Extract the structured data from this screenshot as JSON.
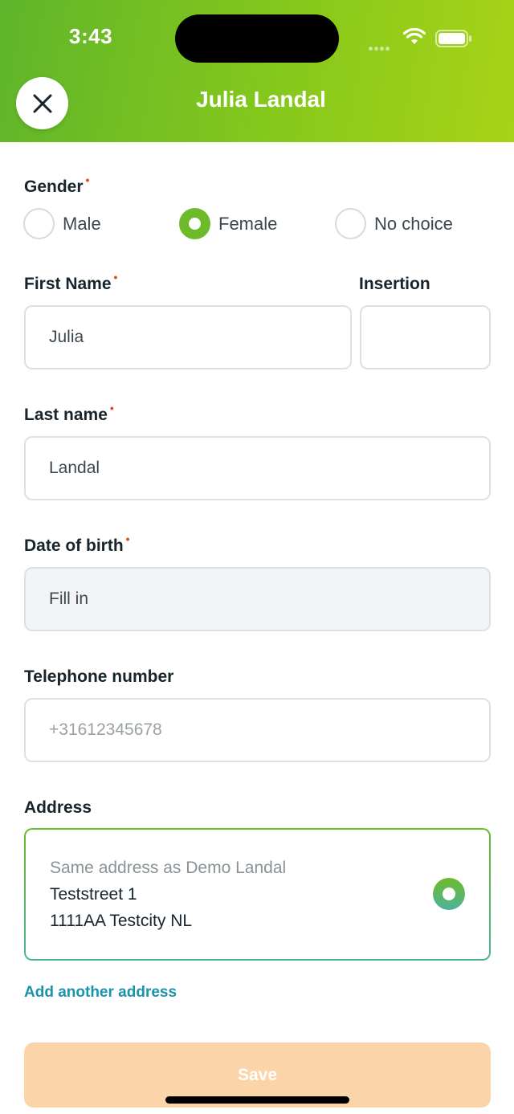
{
  "status_bar": {
    "time": "3:43"
  },
  "header": {
    "title": "Julia Landal"
  },
  "gender": {
    "label": "Gender",
    "required_marker": "•",
    "options": [
      {
        "label": "Male",
        "selected": false
      },
      {
        "label": "Female",
        "selected": true
      },
      {
        "label": "No choice",
        "selected": false
      }
    ]
  },
  "first_name": {
    "label": "First Name",
    "required_marker": "•",
    "value": "Julia"
  },
  "insertion": {
    "label": "Insertion",
    "value": ""
  },
  "last_name": {
    "label": "Last name",
    "required_marker": "•",
    "value": "Landal"
  },
  "date_of_birth": {
    "label": "Date of birth",
    "required_marker": "•",
    "placeholder": "Fill in"
  },
  "telephone": {
    "label": "Telephone number",
    "placeholder": "+31612345678"
  },
  "address": {
    "label": "Address",
    "option": {
      "subtitle": "Same address as Demo Landal",
      "street": "Teststreet 1",
      "city": "1111AA Testcity NL",
      "selected": true
    },
    "add_link": "Add another address"
  },
  "save_button": {
    "label": "Save"
  },
  "colors": {
    "accent_green": "#6dbb2b",
    "link_blue": "#1a93ad",
    "save_disabled": "#fbd5a9",
    "required_red": "#e64a19"
  }
}
